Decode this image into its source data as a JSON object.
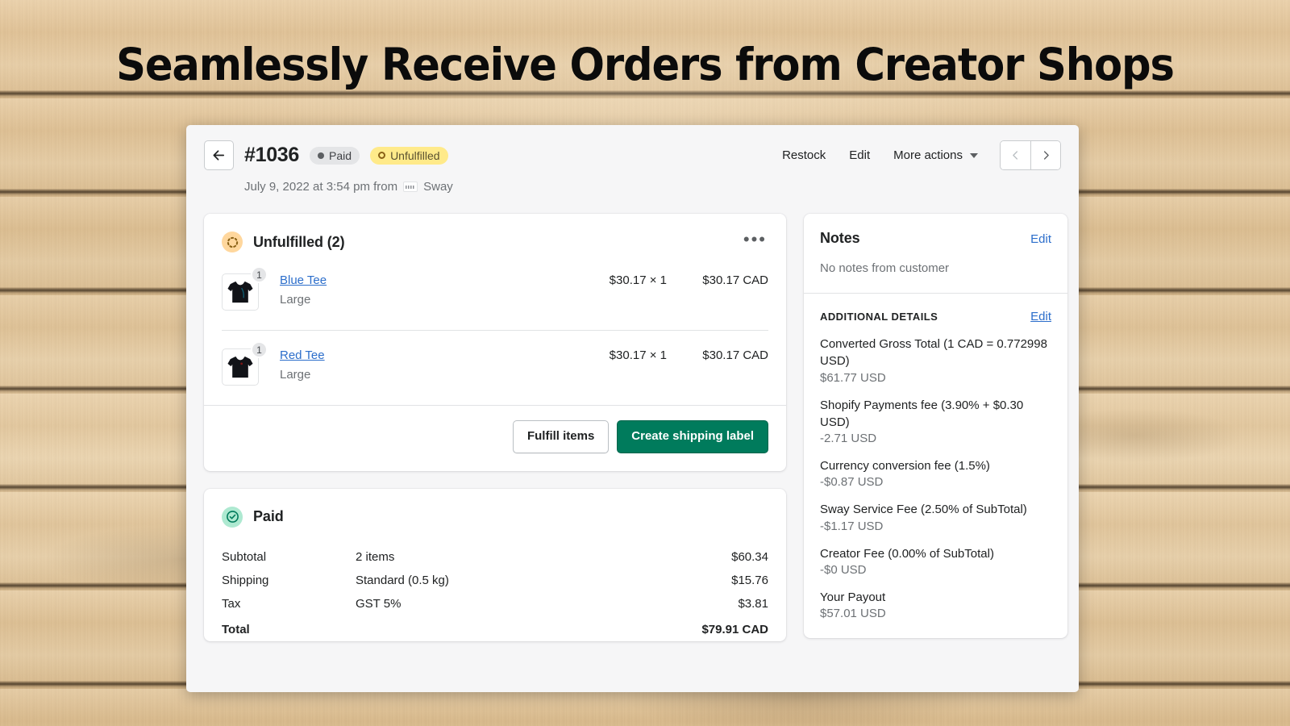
{
  "headline": "Seamlessly Receive Orders from Creator Shops",
  "order_header": {
    "back_icon": "arrow-left-icon",
    "order_number": "#1036",
    "badges": [
      {
        "label": "Paid",
        "icon": "filled-dot-icon",
        "style": "paid"
      },
      {
        "label": "Unfulfilled",
        "icon": "ring-icon",
        "style": "unfulfilled"
      }
    ],
    "actions": [
      "Restock",
      "Edit"
    ],
    "restock_label": "Restock",
    "edit_label": "Edit",
    "more_actions_label": "More actions",
    "prev_icon": "chevron-left-icon",
    "next_icon": "chevron-right-icon",
    "date_prefix": "July 9, 2022 at 3:54 pm from",
    "channel": "Sway",
    "channel_icon": "sway-logo-icon"
  },
  "fulfillment_card": {
    "status_icon": "dashed-ring-icon",
    "title": "Unfulfilled (2)",
    "menu_icon": "ellipsis-icon",
    "items": [
      {
        "name": "Blue Tee",
        "variant": "Large",
        "quantity": "1",
        "unit_price": "$30.17 × 1",
        "line_total": "$30.17 CAD",
        "thumb_color": "#1b3d4d"
      },
      {
        "name": "Red Tee",
        "variant": "Large",
        "quantity": "1",
        "unit_price": "$30.17 × 1",
        "line_total": "$30.17 CAD",
        "thumb_color": "#4d1b1b"
      }
    ],
    "secondary_button": "Fulfill items",
    "primary_button": "Create shipping label"
  },
  "payment_card": {
    "status_icon": "check-circle-icon",
    "title": "Paid",
    "rows": [
      {
        "label": "Subtotal",
        "desc": "2 items",
        "amount": "$60.34"
      },
      {
        "label": "Shipping",
        "desc": "Standard (0.5 kg)",
        "amount": "$15.76"
      },
      {
        "label": "Tax",
        "desc": "GST 5%",
        "amount": "$3.81"
      }
    ],
    "total_label": "Total",
    "total_desc": "",
    "total_amount": "$79.91 CAD"
  },
  "notes": {
    "title": "Notes",
    "edit_label": "Edit",
    "empty_text": "No notes from customer"
  },
  "additional_details": {
    "title": "ADDITIONAL DETAILS",
    "edit_label": "Edit",
    "items": [
      {
        "label": "Converted Gross Total (1 CAD = 0.772998 USD)",
        "value": "$61.77 USD"
      },
      {
        "label": "Shopify Payments fee (3.90% + $0.30 USD)",
        "value": "-2.71 USD"
      },
      {
        "label": "Currency conversion fee (1.5%)",
        "value": "-$0.87 USD"
      },
      {
        "label": "Sway Service Fee (2.50% of SubTotal)",
        "value": "-$1.17 USD"
      },
      {
        "label": "Creator Fee (0.00% of SubTotal)",
        "value": "-$0 USD"
      },
      {
        "label": "Your Payout",
        "value": "$57.01 USD"
      }
    ]
  },
  "colors": {
    "panel_bg": "#f6f6f7",
    "link": "#2c6ecb",
    "primary_button": "#007b5c",
    "unfulfilled_badge": "#ffea8a",
    "paid_icon_bg": "#aee9d1",
    "unfulfilled_icon_bg": "#ffd79d",
    "wood": "#e0c396"
  }
}
